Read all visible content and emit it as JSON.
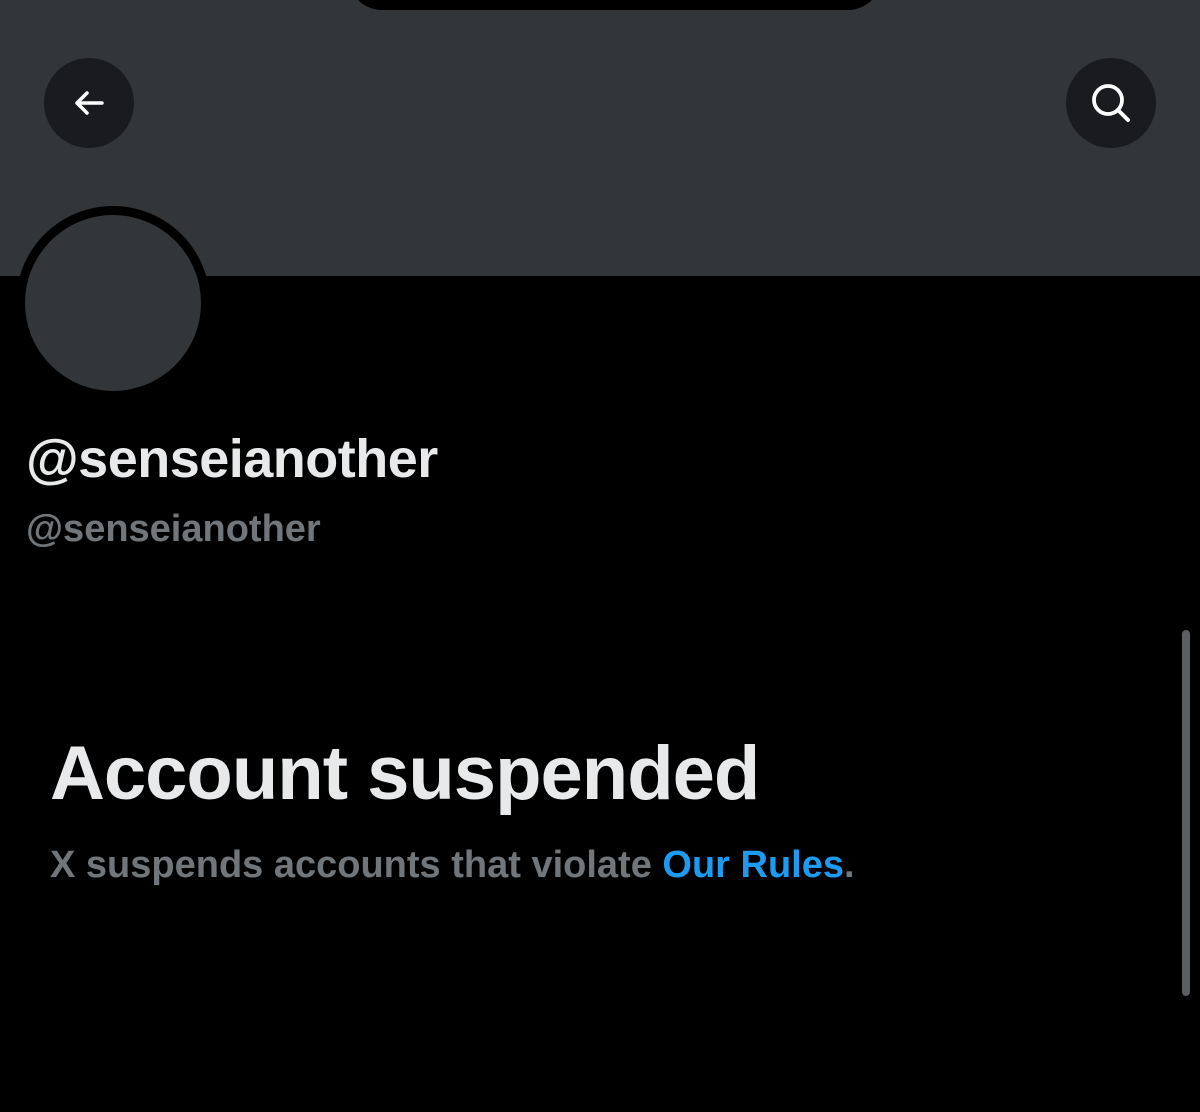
{
  "header": {
    "back_icon": "arrow-left-icon",
    "search_icon": "search-icon"
  },
  "profile": {
    "display_name": "@senseianother",
    "handle": "@senseianother"
  },
  "notice": {
    "title": "Account suspended",
    "text_prefix": "X suspends accounts that violate ",
    "link_label": "Our Rules",
    "text_suffix": "."
  },
  "colors": {
    "background": "#000000",
    "banner": "#333639",
    "primary_text": "#e7e9ea",
    "secondary_text": "#71767b",
    "link": "#1d9bf0"
  }
}
